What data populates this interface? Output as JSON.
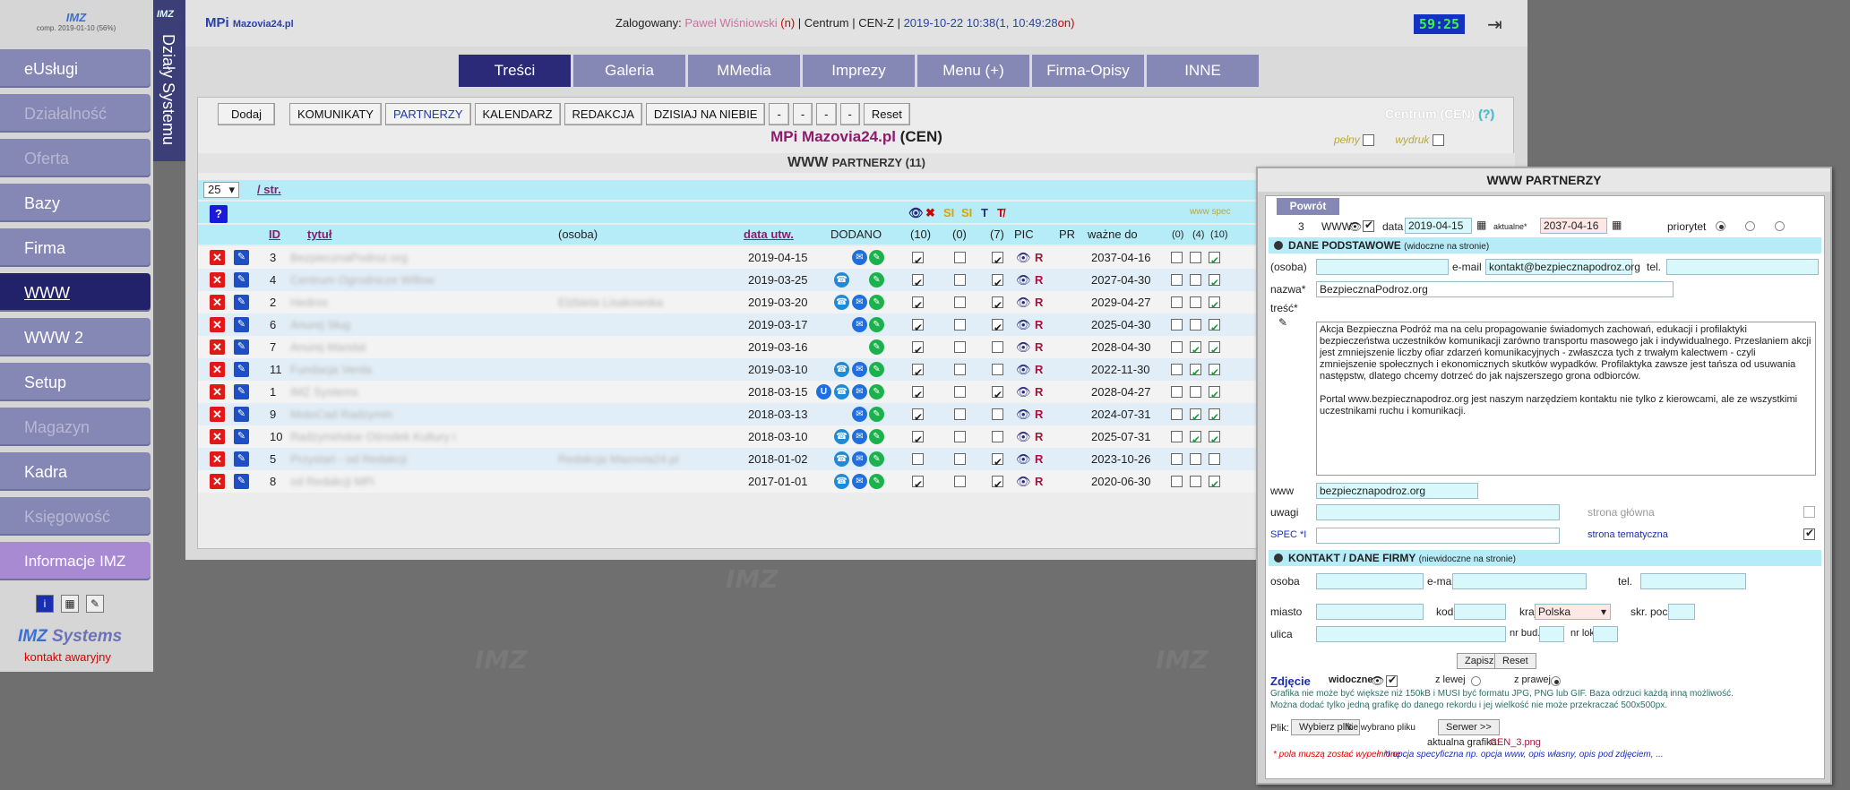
{
  "leftbar": {
    "logo_text": "IMZ",
    "logo_sub": "comp. 2019-01-10 (56%)",
    "items": [
      {
        "label": "eUsługi",
        "state": "normal"
      },
      {
        "label": "Działalność",
        "state": "disabled"
      },
      {
        "label": "Oferta",
        "state": "disabled"
      },
      {
        "label": "Bazy",
        "state": "normal"
      },
      {
        "label": "Firma",
        "state": "normal"
      },
      {
        "label": "WWW",
        "state": "active"
      },
      {
        "label": "WWW 2",
        "state": "normal"
      },
      {
        "label": "Setup",
        "state": "normal"
      },
      {
        "label": "Magazyn",
        "state": "disabled"
      },
      {
        "label": "Kadra",
        "state": "normal"
      },
      {
        "label": "Księgowość",
        "state": "disabled"
      },
      {
        "label": "Informacje IMZ",
        "state": "info"
      }
    ],
    "brand_a": "IMZ",
    "brand_b": "Systems",
    "emergency": "kontakt awaryjny"
  },
  "vstrip": {
    "small": "IMZ",
    "label": "Działy Systemu"
  },
  "header": {
    "app": "MPi",
    "site": "Mazovia24.pl",
    "logged_label": "Zalogowany:",
    "user": "Paweł Wiśniowski",
    "user_flag": "(n)",
    "centrum": "| Centrum | CEN-Z |",
    "datetime": "2019-10-22 10:38(1, 10:49:28",
    "on": "on)",
    "timer": "59:25"
  },
  "tabs": [
    "Treści",
    "Galeria",
    "MMedia",
    "Imprezy",
    "Menu (+)",
    "Firma-Opisy",
    "INNE"
  ],
  "toolbar": {
    "add": "Dodaj",
    "buttons": [
      "KOMUNIKATY",
      "PARTNERZY",
      "KALENDARZ",
      "REDAKCJA",
      "DZISIAJ NA NIEBIE",
      "-",
      "-",
      "-",
      "-"
    ],
    "reset": "Reset"
  },
  "centrum_label": "Centrum (CEN)",
  "centrum_q": "(?)",
  "title_main": "MPi Mazovia24.pl",
  "title_code": "(CEN)",
  "flags": {
    "pelny": "pełny",
    "wydruk": "wydruk"
  },
  "subheading": {
    "a": "WWW",
    "b": "PARTNERZY (11)"
  },
  "pager": {
    "per_page": "25",
    "label": "/ str."
  },
  "filter_icons": [
    "SI",
    "SI",
    "T"
  ],
  "www_spec": "www spec",
  "columns": {
    "id": "ID",
    "title": "tytuł",
    "person": "(osoba)",
    "date": "data utw.",
    "added": "DODANO",
    "c10": "(10)",
    "c0": "(0)",
    "c7": "(7)",
    "pic": "PIC",
    "pr": "PR",
    "valid": "ważne do",
    "s0": "(0)",
    "s4": "(4)",
    "s10": "(10)"
  },
  "rows": [
    {
      "id": "3",
      "title": "BezpiecznaPodroz.org",
      "person": "",
      "date": "2019-04-15",
      "icons": [
        "ml",
        "gr"
      ],
      "c10": true,
      "c0": false,
      "c7": true,
      "valid": "2037-04-16",
      "s0": false,
      "s4": false,
      "s10": true
    },
    {
      "id": "4",
      "title": "Centrum Ogrodnicze Willow",
      "person": "",
      "date": "2019-03-25",
      "icons": [
        "ph",
        "gr"
      ],
      "c10": true,
      "c0": false,
      "c7": true,
      "valid": "2027-04-30",
      "s0": false,
      "s4": false,
      "s10": true
    },
    {
      "id": "2",
      "title": "Hedros",
      "person": "Elżbieta Lisakowska",
      "date": "2019-03-20",
      "icons": [
        "ph",
        "ml",
        "gr"
      ],
      "c10": true,
      "c0": false,
      "c7": true,
      "valid": "2029-04-27",
      "s0": false,
      "s4": false,
      "s10": true
    },
    {
      "id": "6",
      "title": "Anurej Sług",
      "person": "",
      "date": "2019-03-17",
      "icons": [
        "ml",
        "gr"
      ],
      "c10": true,
      "c0": false,
      "c7": true,
      "valid": "2025-04-30",
      "s0": false,
      "s4": false,
      "s10": true
    },
    {
      "id": "7",
      "title": "Anurej Mandat",
      "person": "",
      "date": "2019-03-16",
      "icons": [
        "gr"
      ],
      "c10": true,
      "c0": false,
      "c7": false,
      "valid": "2028-04-30",
      "s0": false,
      "s4": true,
      "s10": true
    },
    {
      "id": "11",
      "title": "Fundacja Verda",
      "person": "",
      "date": "2019-03-10",
      "icons": [
        "ph",
        "ml",
        "gr"
      ],
      "c10": true,
      "c0": false,
      "c7": false,
      "valid": "2022-11-30",
      "s0": false,
      "s4": true,
      "s10": true
    },
    {
      "id": "1",
      "title": "IMZ Systems",
      "person": "",
      "date": "2018-03-15",
      "icons": [
        "u",
        "ph",
        "ml",
        "gr"
      ],
      "c10": true,
      "c0": false,
      "c7": true,
      "valid": "2028-04-27",
      "s0": false,
      "s4": false,
      "s10": true
    },
    {
      "id": "9",
      "title": "MotoCad Radzymin",
      "person": "",
      "date": "2018-03-13",
      "icons": [
        "ml",
        "gr"
      ],
      "c10": true,
      "c0": false,
      "c7": false,
      "valid": "2024-07-31",
      "s0": false,
      "s4": true,
      "s10": true
    },
    {
      "id": "10",
      "title": "Radzymińskie Ośrodek Kultury i",
      "person": "",
      "date": "2018-03-10",
      "icons": [
        "ph",
        "ml",
        "gr"
      ],
      "c10": true,
      "c0": false,
      "c7": false,
      "valid": "2025-07-31",
      "s0": false,
      "s4": true,
      "s10": true
    },
    {
      "id": "5",
      "title": "Przystań - od Redakcji",
      "person": "Redakcja Mazovia24.pl",
      "date": "2018-01-02",
      "icons": [
        "ph",
        "ml",
        "gr"
      ],
      "c10": false,
      "c0": false,
      "c7": true,
      "valid": "2023-10-26",
      "s0": false,
      "s4": false,
      "s10": false
    },
    {
      "id": "8",
      "title": "od Redakcji MPi",
      "person": "",
      "date": "2017-01-01",
      "icons": [
        "ph",
        "ml",
        "gr"
      ],
      "c10": true,
      "c0": false,
      "c7": true,
      "valid": "2020-06-30",
      "s0": false,
      "s4": false,
      "s10": true
    }
  ],
  "dialog": {
    "title": "WWW PARTNERZY",
    "back": "Powrót",
    "id": "3",
    "www_label": "WWW",
    "data_label": "data",
    "data_value": "2019-04-15",
    "actual_label": "aktualne*",
    "actual_value": "2037-04-16",
    "priority_label": "priorytet",
    "section1": "DANE PODSTAWOWE",
    "section1_note": "(widoczne na stronie)",
    "osoba_label": "(osoba)",
    "email_label": "e-mail",
    "email_value": "kontakt@bezpiecznapodroz.org",
    "tel_label": "tel.",
    "name_label": "nazwa*",
    "name_value": "BezpiecznaPodroz.org",
    "content_label": "treść*",
    "content": "Akcja Bezpieczna Podróż ma na celu propagowanie świadomych zachowań, edukacji i profilaktyki bezpieczeństwa uczestników komunikacji zarówno transportu masowego jak i indywidualnego. Przesłaniem akcji jest zmniejszenie liczby ofiar zdarzeń komunikacyjnych - zwłaszcza tych z trwałym kalectwem - czyli zmniejszenie społecznych i ekonomicznych skutków wypadków. Profilaktyka zawsze jest tańsza od usuwania następstw, dlatego chcemy dotrzeć do jak najszerszego grona odbiorców.\n\nPortal www.bezpiecznapodroz.org jest naszym narzędziem kontaktu nie tylko z kierowcami, ale ze wszystkimi uczestnikami ruchu i komunikacji.",
    "www_field_label": "www",
    "www_value": "bezpiecznapodroz.org",
    "uwagi_label": "uwagi",
    "strona_glowna": "strona główna",
    "spec_label": "SPEC *I",
    "strona_tematyczna": "strona tematyczna",
    "section2": "KONTAKT / DANE FIRMY",
    "section2_note": "(niewidoczne na stronie)",
    "osoba2": "osoba",
    "email2": "e-mail",
    "tel2": "tel.",
    "miasto": "miasto",
    "kod": "kod",
    "kraj": "kraj",
    "kraj_value": "Polska",
    "skr": "skr. poczt.",
    "ulica": "ulica",
    "nr_bud": "nr bud.",
    "nr_lok": "nr lok.",
    "save": "Zapisz",
    "reset": "Reset",
    "zdjecie": "Zdjęcie",
    "widoczne": "widoczne",
    "z_lewej": "z lewej",
    "z_prawej": "z prawej",
    "note1": "Grafika nie może być większe niż 150kB i MUSI być formatu JPG, PNG lub GIF. Baza odrzuci każdą inną możliwość.",
    "note2": "Można dodać tylko jedną grafikę do danego rekordu i jej wielkość nie może przekraczać 500x500px.",
    "plik": "Plik:",
    "choose": "Wybierz plik",
    "no_file": "Nie wybrano pliku",
    "server": "Serwer >>",
    "current_label": "aktualna grafika:",
    "current_value": "CEN_3.png",
    "req_note": "* pola muszą zostać wypełnione",
    "opt_note": "*I opcja specyficzna np. opcja www, opis własny, opis pod zdjęciem, ..."
  }
}
